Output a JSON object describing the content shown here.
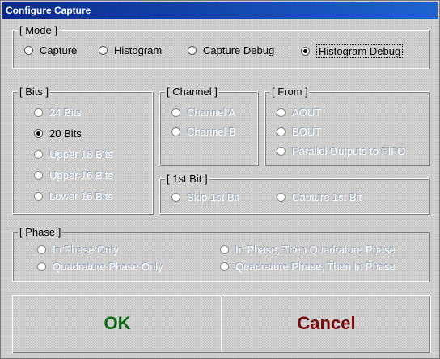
{
  "window": {
    "title": "Configure Capture"
  },
  "mode": {
    "legend": "[ Mode ]",
    "options": [
      {
        "label": "Capture",
        "checked": false
      },
      {
        "label": "Histogram",
        "checked": false
      },
      {
        "label": "Capture Debug",
        "checked": false
      },
      {
        "label": "Histogram Debug",
        "checked": true
      }
    ]
  },
  "bits": {
    "legend": "[ Bits ]",
    "options": [
      {
        "label": "24 Bits",
        "enabled": false
      },
      {
        "label": "20 Bits",
        "enabled": true,
        "checked": true
      },
      {
        "label": "Upper 18 Bits",
        "enabled": false
      },
      {
        "label": "Upper 16 Bits",
        "enabled": false
      },
      {
        "label": "Lower 16 Bits",
        "enabled": false
      }
    ]
  },
  "channel": {
    "legend": "[ Channel ]",
    "options": [
      {
        "label": "Channel A",
        "enabled": false
      },
      {
        "label": "Channel B",
        "enabled": false
      }
    ]
  },
  "from": {
    "legend": "[ From ]",
    "options": [
      {
        "label": "AOUT",
        "enabled": false
      },
      {
        "label": "BOUT",
        "enabled": false
      },
      {
        "label": "Parallel Outputs to FIFO",
        "enabled": false
      }
    ]
  },
  "first_bit": {
    "legend": "[ 1st Bit ]",
    "options": [
      {
        "label": "Skip 1st Bit",
        "enabled": false
      },
      {
        "label": "Capture 1st Bit",
        "enabled": false
      }
    ]
  },
  "phase": {
    "legend": "[ Phase ]",
    "options": [
      {
        "label": "In Phase Only",
        "enabled": false
      },
      {
        "label": "Quadrature Phase Only",
        "enabled": false
      },
      {
        "label": "In Phase, Then Quadrature Phase",
        "enabled": false
      },
      {
        "label": "Quadrature Phase, Then In Phase",
        "enabled": false
      }
    ]
  },
  "buttons": {
    "ok_label": "OK",
    "cancel_label": "Cancel"
  },
  "colors": {
    "ok": "#0a6a14",
    "cancel": "#7a0a0a",
    "titlebar": "#0a2a8a"
  }
}
